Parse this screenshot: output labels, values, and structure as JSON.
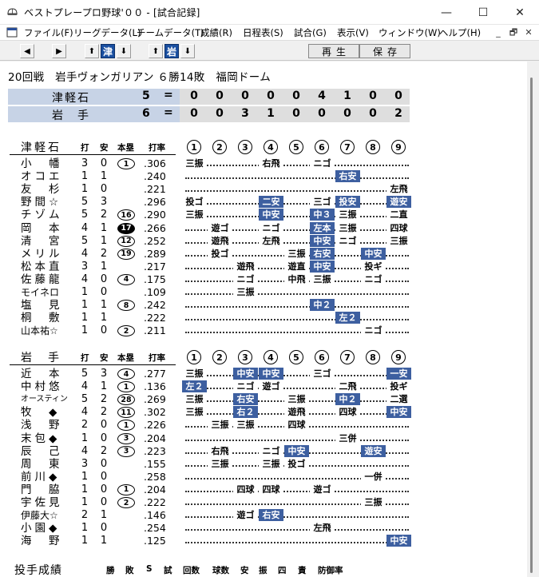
{
  "window": {
    "title": "ベストプレープロ野球'００ - [試合記録]",
    "icon": "baseball-cap-icon",
    "controls": {
      "minimize": "—",
      "maximize": "☐",
      "close": "✕"
    }
  },
  "menu": {
    "items": [
      "ファイル(F)",
      "リーグデータ(L)",
      "チームデータ(T)",
      "成績(R)",
      "日程表(S)",
      "試合(G)",
      "表示(V)",
      "ウィンドウ(W)",
      "ヘルプ(H)"
    ],
    "mdi": [
      "_",
      "🗗",
      "✕"
    ]
  },
  "toolbar": {
    "prev": "◀",
    "next": "▶",
    "team1": "津",
    "team2": "岩",
    "up": "⬆",
    "down": "⬇",
    "play_label": "再生",
    "save_label": "保存"
  },
  "game": {
    "header": "20回戦　岩手ヴォンガリアン ６勝14敗　福岡ドーム"
  },
  "linescore": [
    {
      "team": "津軽石",
      "runs": "5",
      "eq": "=",
      "innings": [
        "0",
        "0",
        "0",
        "0",
        "0",
        "4",
        "1",
        "0",
        "0"
      ]
    },
    {
      "team": "岩　手",
      "runs": "6",
      "eq": "=",
      "innings": [
        "0",
        "0",
        "3",
        "1",
        "0",
        "0",
        "0",
        "0",
        "2"
      ]
    }
  ],
  "columns": {
    "ab": "打",
    "hits": "安",
    "hr": "本塁",
    "avg": "打率",
    "innings": [
      "1",
      "2",
      "3",
      "4",
      "5",
      "6",
      "7",
      "8",
      "9"
    ]
  },
  "batting": [
    {
      "team": "津軽石",
      "rows": [
        {
          "name": "小　幡",
          "ab": "3",
          "h": "0",
          "hr": "1",
          "hr_style": "",
          "avg": ".306",
          "dots_from": 1,
          "dots_to": 6,
          "results": [
            {
              "inning": 1,
              "text": "三振",
              "hit": false
            },
            {
              "inning": 4,
              "text": "右飛",
              "hit": false
            },
            {
              "inning": 6,
              "text": "ニゴ",
              "hit": false
            }
          ]
        },
        {
          "name": "オコエ",
          "ab": "1",
          "h": "1",
          "hr": "",
          "hr_style": "",
          "avg": ".240",
          "dots_from": 1,
          "dots_to": 9,
          "results": [
            {
              "inning": 7,
              "text": "右安",
              "hit": true
            }
          ]
        },
        {
          "name": "友　杉",
          "ab": "1",
          "h": "0",
          "hr": "",
          "hr_style": "",
          "avg": ".221",
          "dots_from": 1,
          "dots_to": 9,
          "results": [
            {
              "inning": 9,
              "text": "左飛",
              "hit": false
            }
          ]
        },
        {
          "name": "野間☆",
          "ab": "5",
          "h": "3",
          "hr": "",
          "hr_style": "",
          "avg": ".296",
          "dots_from": 1,
          "dots_to": 9,
          "results": [
            {
              "inning": 1,
              "text": "投ゴ",
              "hit": false
            },
            {
              "inning": 4,
              "text": "二安",
              "hit": true
            },
            {
              "inning": 6,
              "text": "三ゴ",
              "hit": false
            },
            {
              "inning": 7,
              "text": "投安",
              "hit": true
            },
            {
              "inning": 9,
              "text": "遊安",
              "hit": true
            }
          ]
        },
        {
          "name": "チゾム",
          "ab": "5",
          "h": "2",
          "hr": "16",
          "hr_style": "",
          "avg": ".290",
          "dots_from": 1,
          "dots_to": 9,
          "results": [
            {
              "inning": 1,
              "text": "三振",
              "hit": false
            },
            {
              "inning": 4,
              "text": "中安",
              "hit": true
            },
            {
              "inning": 6,
              "text": "中３",
              "hit": true
            },
            {
              "inning": 7,
              "text": "三振",
              "hit": false
            },
            {
              "inning": 9,
              "text": "二直",
              "hit": false
            }
          ]
        },
        {
          "name": "岡　本",
          "ab": "4",
          "h": "1",
          "hr": "17",
          "hr_style": "filled",
          "avg": ".266",
          "dots_from": 1,
          "dots_to": 9,
          "results": [
            {
              "inning": 2,
              "text": "遊ゴ",
              "hit": false
            },
            {
              "inning": 4,
              "text": "ニゴ",
              "hit": false
            },
            {
              "inning": 6,
              "text": "左本",
              "hit": true
            },
            {
              "inning": 7,
              "text": "三振",
              "hit": false
            },
            {
              "inning": 9,
              "text": "四球",
              "hit": false
            }
          ]
        },
        {
          "name": "清　宮",
          "ab": "5",
          "h": "1",
          "hr": "12",
          "hr_style": "",
          "avg": ".252",
          "dots_from": 1,
          "dots_to": 9,
          "results": [
            {
              "inning": 2,
              "text": "遊飛",
              "hit": false
            },
            {
              "inning": 4,
              "text": "左飛",
              "hit": false
            },
            {
              "inning": 6,
              "text": "中安",
              "hit": true
            },
            {
              "inning": 7,
              "text": "ニゴ",
              "hit": false
            },
            {
              "inning": 9,
              "text": "三振",
              "hit": false
            }
          ]
        },
        {
          "name": "メリル",
          "ab": "4",
          "h": "2",
          "hr": "19",
          "hr_style": "",
          "avg": ".289",
          "dots_from": 1,
          "dots_to": 9,
          "results": [
            {
              "inning": 2,
              "text": "投ゴ",
              "hit": false
            },
            {
              "inning": 5,
              "text": "三振",
              "hit": false
            },
            {
              "inning": 6,
              "text": "右安",
              "hit": true
            },
            {
              "inning": 8,
              "text": "中安",
              "hit": true
            }
          ]
        },
        {
          "name": "松本直",
          "ab": "3",
          "h": "1",
          "hr": "",
          "hr_style": "",
          "avg": ".217",
          "dots_from": 1,
          "dots_to": 9,
          "results": [
            {
              "inning": 3,
              "text": "遊飛",
              "hit": false
            },
            {
              "inning": 5,
              "text": "遊直",
              "hit": false
            },
            {
              "inning": 6,
              "text": "中安",
              "hit": true
            },
            {
              "inning": 8,
              "text": "投ギ",
              "hit": false
            }
          ]
        },
        {
          "name": "佐藤龍",
          "ab": "4",
          "h": "0",
          "hr": "4",
          "hr_style": "",
          "avg": ".175",
          "dots_from": 1,
          "dots_to": 9,
          "results": [
            {
              "inning": 3,
              "text": "ニゴ",
              "hit": false
            },
            {
              "inning": 5,
              "text": "中飛",
              "hit": false
            },
            {
              "inning": 6,
              "text": "三振",
              "hit": false
            },
            {
              "inning": 8,
              "text": "ニゴ",
              "hit": false
            }
          ]
        },
        {
          "name": "モイネロ",
          "ab": "1",
          "h": "0",
          "hr": "",
          "hr_style": "",
          "avg": ".109",
          "dots_from": 1,
          "dots_to": 9,
          "results": [
            {
              "inning": 3,
              "text": "三振",
              "hit": false
            }
          ]
        },
        {
          "name": "塩　見",
          "ab": "1",
          "h": "1",
          "hr": "8",
          "hr_style": "",
          "avg": ".242",
          "dots_from": 1,
          "dots_to": 9,
          "results": [
            {
              "inning": 6,
              "text": "中２",
              "hit": true
            }
          ]
        },
        {
          "name": "桐　敷",
          "ab": "1",
          "h": "1",
          "hr": "",
          "hr_style": "",
          "avg": ".222",
          "dots_from": 1,
          "dots_to": 9,
          "results": [
            {
              "inning": 7,
              "text": "左２",
              "hit": true
            }
          ]
        },
        {
          "name": "山本祐☆",
          "ab": "1",
          "h": "0",
          "hr": "2",
          "hr_style": "",
          "avg": ".211",
          "dots_from": 1,
          "dots_to": 9,
          "results": [
            {
              "inning": 8,
              "text": "ニゴ",
              "hit": false
            }
          ]
        }
      ]
    },
    {
      "team": "岩　手",
      "rows": [
        {
          "name": "近　本",
          "ab": "5",
          "h": "3",
          "hr": "4",
          "hr_style": "",
          "avg": ".277",
          "dots_from": 1,
          "dots_to": 9,
          "results": [
            {
              "inning": 1,
              "text": "三振",
              "hit": false
            },
            {
              "inning": 3,
              "text": "中安",
              "hit": true
            },
            {
              "inning": 4,
              "text": "中安",
              "hit": true
            },
            {
              "inning": 6,
              "text": "三ゴ",
              "hit": false
            },
            {
              "inning": 9,
              "text": "一安",
              "hit": true
            }
          ]
        },
        {
          "name": "中村悠",
          "ab": "4",
          "h": "1",
          "hr": "1",
          "hr_style": "",
          "avg": ".136",
          "dots_from": 1,
          "dots_to": 9,
          "results": [
            {
              "inning": 1,
              "text": "左２",
              "hit": true
            },
            {
              "inning": 3,
              "text": "ニゴ",
              "hit": false
            },
            {
              "inning": 4,
              "text": "遊ゴ",
              "hit": false
            },
            {
              "inning": 7,
              "text": "二飛",
              "hit": false
            },
            {
              "inning": 9,
              "text": "投ギ",
              "hit": false
            }
          ]
        },
        {
          "name": "オースティン",
          "ab": "5",
          "h": "2",
          "hr": "28",
          "hr_style": "",
          "avg": ".269",
          "dots_from": 1,
          "dots_to": 9,
          "results": [
            {
              "inning": 1,
              "text": "三振",
              "hit": false
            },
            {
              "inning": 3,
              "text": "右安",
              "hit": true
            },
            {
              "inning": 5,
              "text": "三振",
              "hit": false
            },
            {
              "inning": 7,
              "text": "中２",
              "hit": true
            },
            {
              "inning": 9,
              "text": "二選",
              "hit": false
            }
          ]
        },
        {
          "name": "牧　◆",
          "ab": "4",
          "h": "2",
          "hr": "11",
          "hr_style": "",
          "avg": ".302",
          "dots_from": 1,
          "dots_to": 9,
          "results": [
            {
              "inning": 1,
              "text": "三振",
              "hit": false
            },
            {
              "inning": 3,
              "text": "右２",
              "hit": true
            },
            {
              "inning": 5,
              "text": "遊飛",
              "hit": false
            },
            {
              "inning": 7,
              "text": "四球",
              "hit": false
            },
            {
              "inning": 9,
              "text": "中安",
              "hit": true
            }
          ]
        },
        {
          "name": "浅　野",
          "ab": "2",
          "h": "0",
          "hr": "1",
          "hr_style": "",
          "avg": ".226",
          "dots_from": 1,
          "dots_to": 9,
          "results": [
            {
              "inning": 2,
              "text": "三振",
              "hit": false
            },
            {
              "inning": 3,
              "text": "三振",
              "hit": false
            },
            {
              "inning": 5,
              "text": "四球",
              "hit": false
            }
          ]
        },
        {
          "name": "末包◆",
          "ab": "1",
          "h": "0",
          "hr": "3",
          "hr_style": "",
          "avg": ".204",
          "dots_from": 1,
          "dots_to": 9,
          "results": [
            {
              "inning": 7,
              "text": "三併",
              "hit": false
            }
          ]
        },
        {
          "name": "辰　己",
          "ab": "4",
          "h": "2",
          "hr": "3",
          "hr_style": "",
          "avg": ".223",
          "dots_from": 1,
          "dots_to": 9,
          "results": [
            {
              "inning": 2,
              "text": "右飛",
              "hit": false
            },
            {
              "inning": 4,
              "text": "ニゴ",
              "hit": false
            },
            {
              "inning": 5,
              "text": "中安",
              "hit": true
            },
            {
              "inning": 8,
              "text": "遊安",
              "hit": true
            }
          ]
        },
        {
          "name": "周　東",
          "ab": "3",
          "h": "0",
          "hr": "",
          "hr_style": "",
          "avg": ".155",
          "dots_from": 1,
          "dots_to": 9,
          "results": [
            {
              "inning": 2,
              "text": "三振",
              "hit": false
            },
            {
              "inning": 4,
              "text": "三振",
              "hit": false
            },
            {
              "inning": 5,
              "text": "投ゴ",
              "hit": false
            }
          ]
        },
        {
          "name": "前川◆",
          "ab": "1",
          "h": "0",
          "hr": "",
          "hr_style": "",
          "avg": ".258",
          "dots_from": 1,
          "dots_to": 9,
          "results": [
            {
              "inning": 8,
              "text": "一併",
              "hit": false
            }
          ]
        },
        {
          "name": "門　脇",
          "ab": "1",
          "h": "0",
          "hr": "1",
          "hr_style": "",
          "avg": ".204",
          "dots_from": 1,
          "dots_to": 9,
          "results": [
            {
              "inning": 3,
              "text": "四球",
              "hit": false
            },
            {
              "inning": 4,
              "text": "四球",
              "hit": false
            },
            {
              "inning": 6,
              "text": "遊ゴ",
              "hit": false
            }
          ]
        },
        {
          "name": "宇佐見",
          "ab": "1",
          "h": "0",
          "hr": "2",
          "hr_style": "",
          "avg": ".222",
          "dots_from": 1,
          "dots_to": 9,
          "results": [
            {
              "inning": 8,
              "text": "三振",
              "hit": false
            }
          ]
        },
        {
          "name": "伊藤大☆",
          "ab": "2",
          "h": "1",
          "hr": "",
          "hr_style": "",
          "avg": ".146",
          "dots_from": 1,
          "dots_to": 9,
          "results": [
            {
              "inning": 3,
              "text": "遊ゴ",
              "hit": false
            },
            {
              "inning": 4,
              "text": "右安",
              "hit": true
            }
          ]
        },
        {
          "name": "小園◆",
          "ab": "1",
          "h": "0",
          "hr": "",
          "hr_style": "",
          "avg": ".254",
          "dots_from": 1,
          "dots_to": 9,
          "results": [
            {
              "inning": 6,
              "text": "左飛",
              "hit": false
            }
          ]
        },
        {
          "name": "海　野",
          "ab": "1",
          "h": "1",
          "hr": "",
          "hr_style": "",
          "avg": ".125",
          "dots_from": 1,
          "dots_to": 9,
          "results": [
            {
              "inning": 9,
              "text": "中安",
              "hit": true
            }
          ]
        }
      ]
    }
  ],
  "pitching": {
    "title": "投手成績",
    "columns": [
      "勝",
      "敗",
      "S",
      "試",
      "回数",
      "球数",
      "安",
      "振",
      "四",
      "責",
      "防御率"
    ]
  }
}
